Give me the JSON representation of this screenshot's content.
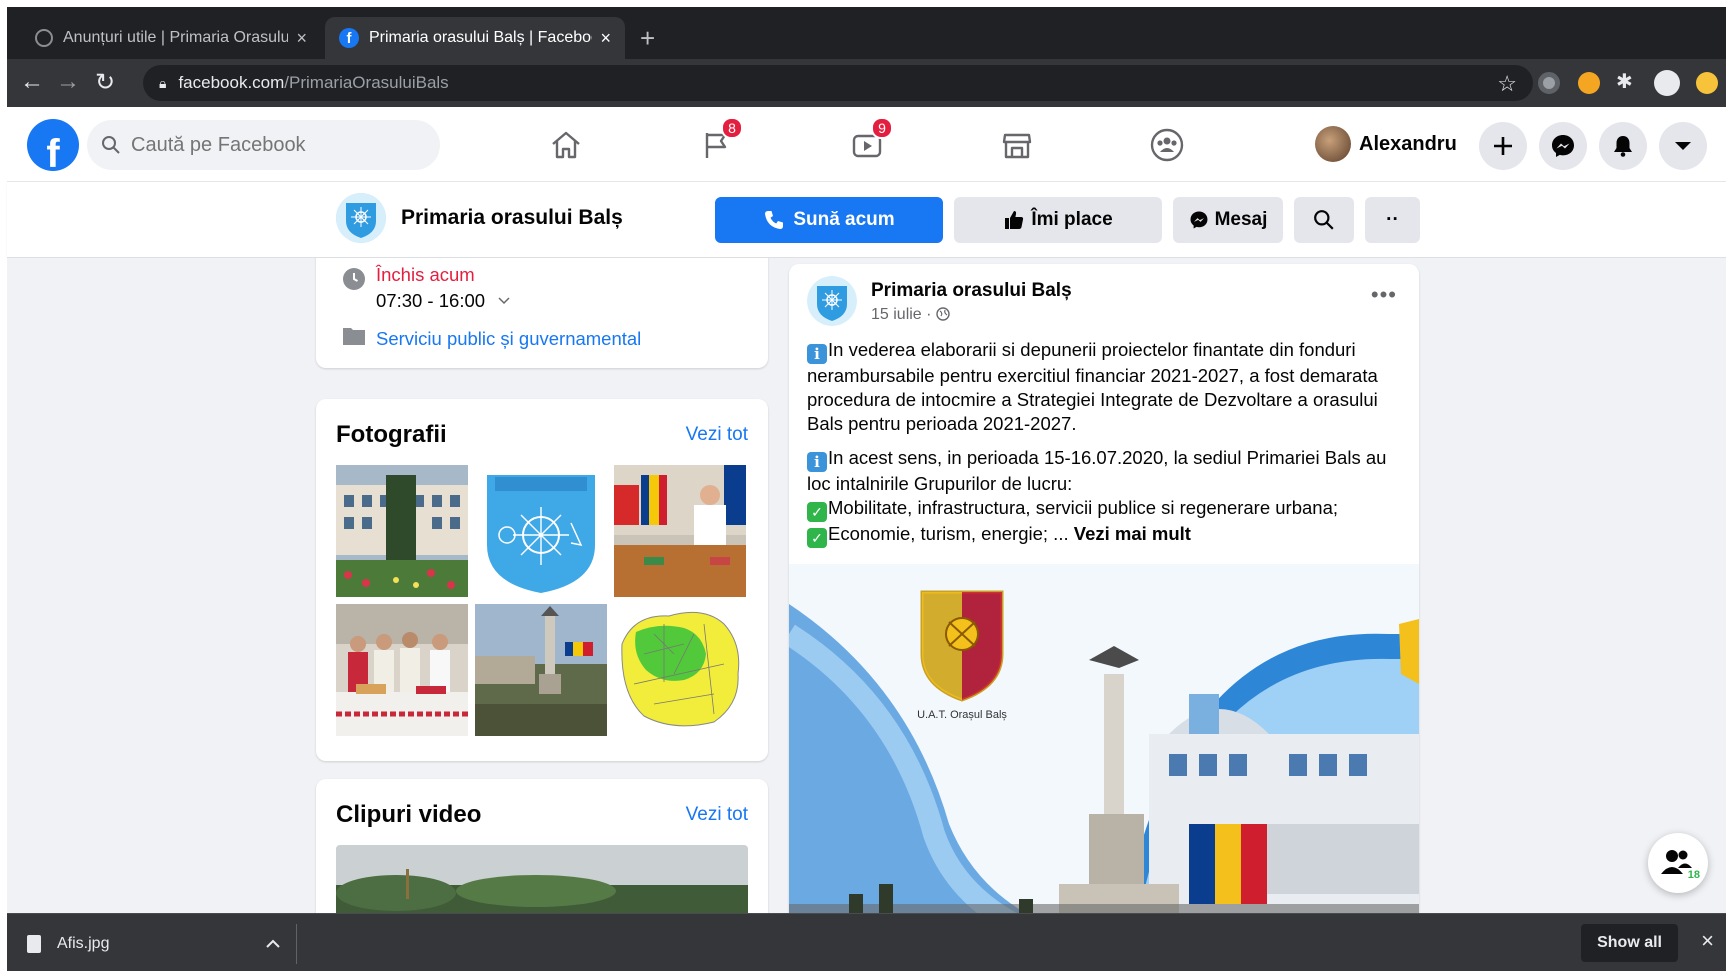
{
  "browser": {
    "tabs": [
      {
        "title": "Anunțuri utile | Primaria Orasului Bals",
        "active": false
      },
      {
        "title": "Primaria orasului Balș | Facebook",
        "active": true
      }
    ],
    "new_tab": "+",
    "tab_close": "×",
    "url_host": "facebook.com",
    "url_path": "/PrimariaOrasuluiBals"
  },
  "fb_header": {
    "logo": "f",
    "search_placeholder": "Caută pe Facebook",
    "nav": [
      {
        "icon": "home-icon",
        "badge": ""
      },
      {
        "icon": "flag-icon",
        "badge": "8"
      },
      {
        "icon": "video-icon",
        "badge": "9"
      },
      {
        "icon": "marketplace-icon",
        "badge": ""
      },
      {
        "icon": "groups-icon",
        "badge": ""
      }
    ],
    "user_name": "Alexandru"
  },
  "page_header": {
    "page_name": "Primaria orasului Balș",
    "call_label": "Sună acum",
    "like_label": "Îmi place",
    "message_label": "Mesaj",
    "more_label": "··"
  },
  "about": {
    "status": "Închis acum",
    "hours": "07:30 - 16:00",
    "category": "Serviciu public și guvernamental"
  },
  "photos": {
    "title": "Fotografii",
    "see_all": "Vezi tot"
  },
  "videos": {
    "title": "Clipuri video",
    "see_all": "Vezi tot"
  },
  "post": {
    "author": "Primaria orasului Balș",
    "date": "15 iulie",
    "more": "•••",
    "paragraph1": "In vederea elaborarii si depunerii proiectelor finantate din fonduri nerambursabile pentru exercitiul financiar 2021-2027, a fost demarata procedura de intocmire a Strategiei Integrate de Dezvoltare a orasului Bals pentru perioada 2021-2027.",
    "paragraph2": "In acest sens, in perioada 15-16.07.2020, la sediul Primariei Bals au loc intalnirile Grupurilor de lucru:",
    "bullet1": "Mobilitate, infrastructura, servicii publice si regenerare urbana;",
    "bullet2": "Economie, turism, energie; ...",
    "see_more": "Vezi mai mult",
    "image_caption": "U.A.T. Orașul Balș"
  },
  "float_contacts_count": "18",
  "download_bar": {
    "file_name": "Afis.jpg",
    "show_all": "Show all",
    "close": "×"
  },
  "colors": {
    "fb_blue": "#1877f2",
    "badge_red": "#e41e3f",
    "closed_red": "#e41e3f",
    "chrome_dark": "#202124"
  }
}
